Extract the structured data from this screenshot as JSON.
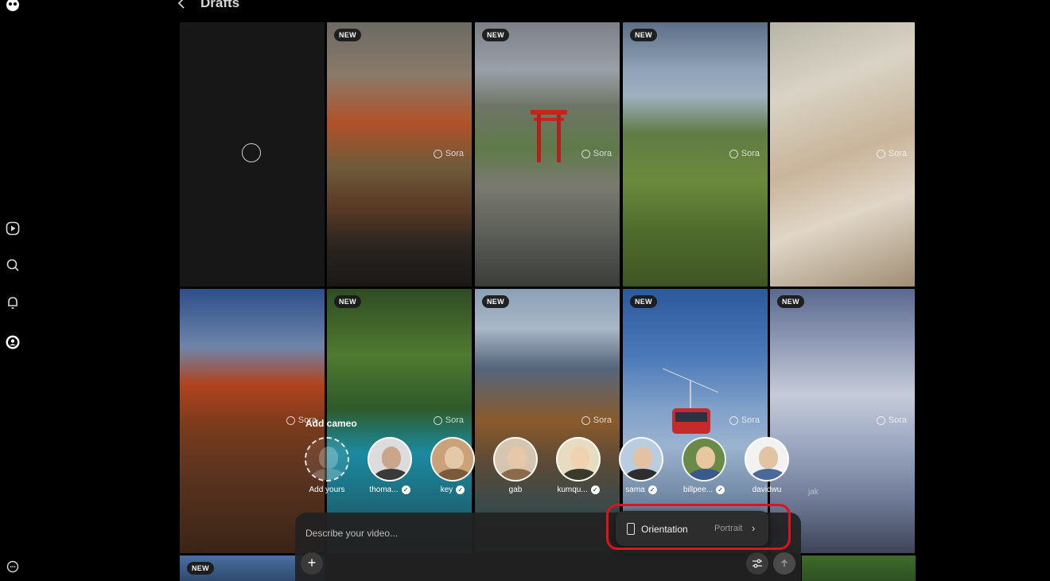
{
  "header": {
    "title": "Drafts",
    "back_icon": "chevron-left-icon"
  },
  "rail": {
    "items": [
      {
        "name": "logo",
        "icon": "sora-logo-icon"
      },
      {
        "name": "feed",
        "icon": "play-circle-icon"
      },
      {
        "name": "search",
        "icon": "search-icon"
      },
      {
        "name": "notifications",
        "icon": "bell-icon"
      },
      {
        "name": "profile",
        "icon": "profile-icon"
      },
      {
        "name": "more",
        "icon": "more-icon"
      }
    ]
  },
  "grid": {
    "badge_label": "NEW",
    "watermark": "Sora",
    "tiles": [
      {
        "kind": "loading",
        "new": false
      },
      {
        "kind": "autumn-lake",
        "new": true
      },
      {
        "kind": "torii",
        "new": true
      },
      {
        "kind": "meadow",
        "new": true
      },
      {
        "kind": "latte",
        "new": false
      },
      {
        "kind": "boardwalk",
        "new": false
      },
      {
        "kind": "forest",
        "new": true
      },
      {
        "kind": "valley",
        "new": true
      },
      {
        "kind": "gondola",
        "new": true
      },
      {
        "kind": "snow",
        "new": true
      }
    ]
  },
  "cameos": {
    "title": "Add cameo",
    "items": [
      {
        "name": "Add yours",
        "verified": false
      },
      {
        "name": "thoma...",
        "verified": true
      },
      {
        "name": "key",
        "verified": true
      },
      {
        "name": "gab",
        "verified": false
      },
      {
        "name": "kumqu...",
        "verified": true
      },
      {
        "name": "sama",
        "verified": true
      },
      {
        "name": "billpee...",
        "verified": true
      },
      {
        "name": "davidwu",
        "verified": false
      }
    ],
    "peek_label": "jak"
  },
  "composer": {
    "placeholder": "Describe your video...",
    "add_label": "+",
    "settings_icon": "sliders-icon",
    "send_icon": "arrow-up-icon"
  },
  "orientation": {
    "label": "Orientation",
    "value": "Portrait",
    "chevron": "›",
    "highlight_color": "#e0121d"
  },
  "colors": {
    "background": "#000000",
    "panel": "#222222",
    "popover": "#2d2d2d"
  }
}
